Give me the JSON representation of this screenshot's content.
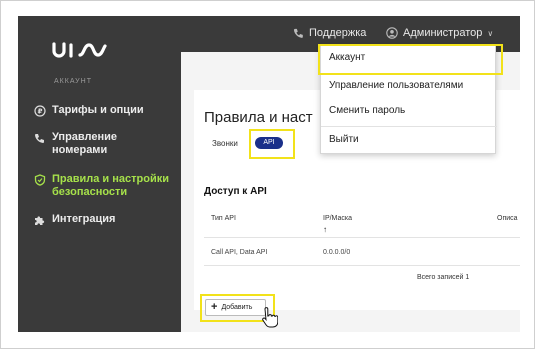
{
  "sidebar": {
    "logo_alt": "uis",
    "section_label": "АККАУНТ",
    "items": [
      {
        "label": "Тарифы и опции",
        "icon": "coin-icon"
      },
      {
        "label": "Управление номерами",
        "icon": "phone-settings-icon"
      },
      {
        "label": "Правила и настройки безопасности",
        "icon": "shield-icon",
        "active": true
      },
      {
        "label": "Интеграция",
        "icon": "puzzle-icon"
      }
    ]
  },
  "topbar": {
    "support_label": "Поддержка",
    "admin_label": "Администратор"
  },
  "dropdown": {
    "items": [
      "Аккаунт",
      "Управление пользователями",
      "Сменить пароль",
      "Выйти"
    ]
  },
  "main": {
    "page_title": "Правила и настройки безопасности",
    "tabs": [
      "Звонки",
      "API"
    ],
    "section_title": "Доступ к API",
    "table": {
      "headers": [
        "Тип API",
        "IP/Маска",
        "Описание"
      ],
      "rows": [
        [
          "Call API, Data API",
          "0.0.0.0/0",
          ""
        ]
      ],
      "total": "Всего записей 1"
    },
    "add_button": "Добавить"
  },
  "colors": {
    "sidebar_bg": "#3a3a3a",
    "active": "#a6e14a",
    "api_tab": "#1a2f8a",
    "highlight": "#f2e21a"
  }
}
